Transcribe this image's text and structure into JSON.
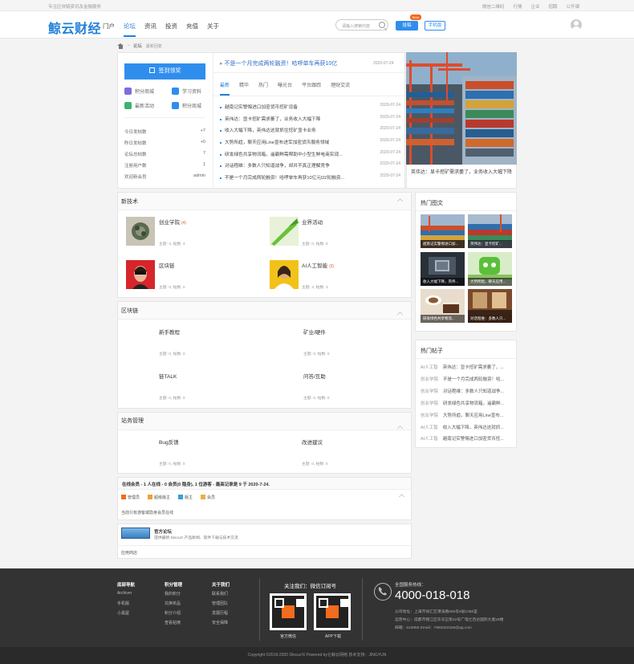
{
  "topbar": {
    "tagline": "专注区块链资讯及金融服务",
    "links": [
      "微信二维码",
      "行情",
      "企业",
      "招聘",
      "公开课"
    ]
  },
  "header": {
    "logo": "鲸云财经",
    "nav": [
      "门户",
      "论坛",
      "资讯",
      "投资",
      "充值",
      "关于"
    ],
    "active_nav": "论坛",
    "search_placeholder": "请输入搜索内容",
    "post_button": "投稿",
    "beta_badge": "Beta",
    "mobile_button": "手机版"
  },
  "breadcrumb": [
    "论坛",
    "最新回复"
  ],
  "user_panel": {
    "sign_button": "签到领奖",
    "quick": [
      {
        "label": "积分商城",
        "color": "#7f6be0"
      },
      {
        "label": "学习资料",
        "color": "#2f8eed"
      },
      {
        "label": "最新活动",
        "color": "#3cb371"
      },
      {
        "label": "积分商城",
        "color": "#2f8eed"
      }
    ],
    "stats": [
      {
        "label": "今日发帖数",
        "value": "+7"
      },
      {
        "label": "昨日发帖数",
        "value": "+0"
      },
      {
        "label": "论坛总帖数",
        "value": "7"
      },
      {
        "label": "注册用户数",
        "value": "1"
      },
      {
        "label": "欢迎新会员",
        "value": "admin"
      }
    ]
  },
  "news": {
    "headline": "不是一个月完成两轮融资！哈啰单车再获10亿",
    "headline_date": "2020-07-24",
    "tabs": [
      "最新",
      "精华",
      "热门",
      "曝光台",
      "平台跟踪",
      "理财交流"
    ],
    "items": [
      {
        "title": "越南记实警惕进口加密货币挖矿设备",
        "date": "2020-07-24"
      },
      {
        "title": "英伟达：显卡挖矿需求萎了，业务收入大幅下降",
        "date": "2020-07-24"
      },
      {
        "title": "收入大幅下降，英伟达这就抓住挖矿显卡业务",
        "date": "2020-07-24"
      },
      {
        "title": "大势所趋，聊天应用Line宣布进军加密货币服务领域",
        "date": "2020-07-24"
      },
      {
        "title": "研发绿色共享物流箱，遥霸鲜需帮助中小型生鲜电商实现...",
        "date": "2020-07-24"
      },
      {
        "title": "对话程维：多数人只知道战争，却并不真正理解竞争",
        "date": "2020-07-24"
      },
      {
        "title": "不是一个月完成两轮融资！哈啰单车再获10亿元D2轮融资...",
        "date": "2020-07-24"
      }
    ]
  },
  "banner": {
    "caption": "英伟达：显卡挖矿需求萎了，业务收入大幅下降"
  },
  "sections": [
    {
      "title": "新技术",
      "forums": [
        {
          "name": "创业学院",
          "count": "(4)",
          "meta": "主题: 4, 帖数: 4"
        },
        {
          "name": "业界活动",
          "count": "",
          "meta": "主题: 0, 帖数: 0"
        },
        {
          "name": "区块链",
          "count": "",
          "meta": "主题: 0, 帖数: 0"
        },
        {
          "name": "AI人工智能",
          "count": "(3)",
          "meta": "主题: 3, 帖数: 3"
        }
      ]
    },
    {
      "title": "区块链",
      "forums": [
        {
          "name": "新手教程",
          "meta": "主题: 0, 帖数: 0"
        },
        {
          "name": "矿业/硬件",
          "meta": "主题: 0, 帖数: 0"
        },
        {
          "name": "链TALK",
          "meta": "主题: 0, 帖数: 0"
        },
        {
          "name": "问答/互助",
          "meta": "主题: 0, 帖数: 0"
        }
      ]
    },
    {
      "title": "站务管理",
      "forums": [
        {
          "name": "Bug反馈",
          "meta": "主题: 0, 帖数: 0"
        },
        {
          "name": "改进建议",
          "meta": "主题: 0, 帖数: 0"
        }
      ]
    }
  ],
  "online": {
    "summary": "在线会员 - 1 人在线 - 0 会员(0 隐身), 1 位游客 - 最高记录是 9 于 2020-7-24.",
    "legend": [
      "管理员",
      "超级版主",
      "版主",
      "会员"
    ],
    "note": "当前只有游客或隐身会员在线"
  },
  "official": {
    "title": "官方论坛",
    "desc": "提供最新 Discuz! 产品新闻、软件下载与技术交流",
    "apps": "应用商店"
  },
  "hot_images": {
    "title": "热门图文",
    "captions": [
      "越南记实警惕进口加...",
      "英伟达：显卡挖矿...",
      "收入大幅下降，英伟...",
      "大势所趋，聊天应用...",
      "研发绿色共享物流...",
      "对话程维：多数人只..."
    ]
  },
  "hot_posts": {
    "title": "热门帖子",
    "items": [
      {
        "tag": "AI人工智",
        "title": "英伟达：显卡挖矿需求萎了，..."
      },
      {
        "tag": "创业学院",
        "title": "不是一个月完成两轮融资！哈..."
      },
      {
        "tag": "创业学院",
        "title": "对话程维：多数人只知道战争..."
      },
      {
        "tag": "创业学院",
        "title": "研发绿色共享物流箱，遥霸鲜..."
      },
      {
        "tag": "创业学院",
        "title": "大势所趋，聊天应用Line宣布..."
      },
      {
        "tag": "AI人工智",
        "title": "收入大幅下降，英伟达这就抓..."
      },
      {
        "tag": "AI人工智",
        "title": "越南记实警惕进口加密货币挖..."
      }
    ]
  },
  "footer": {
    "cols": [
      {
        "title": "底部导航",
        "items": [
          "Archiver",
          "手机版",
          "小黑屋"
        ]
      },
      {
        "title": "积分管理",
        "items": [
          "我的积分",
          "兑换奖品",
          "积分介绍",
          "查看帖榜"
        ]
      },
      {
        "title": "关于我们",
        "items": [
          "联系我们",
          "管理团队",
          "发展历程",
          "安全保障"
        ]
      }
    ],
    "follow_title": "关注我们：微信订阅号",
    "qr_labels": [
      "官方微信",
      "APP下载"
    ],
    "service_title": "全国服务热线：",
    "phone": "4000-018-018",
    "address": "公司地址：上海市徐汇区漕溪路655号8层1068室",
    "center": "运营中心：成都市锦江区东华正街42号广电仕百达国际大厦29楼",
    "email": "邮箱：610066 Email：7992022226@qq.com",
    "copyright": "Copyright   ©2019-2020  Discuz!X  Powered by仑鲸云网络  技术支持：JINGYUN"
  }
}
